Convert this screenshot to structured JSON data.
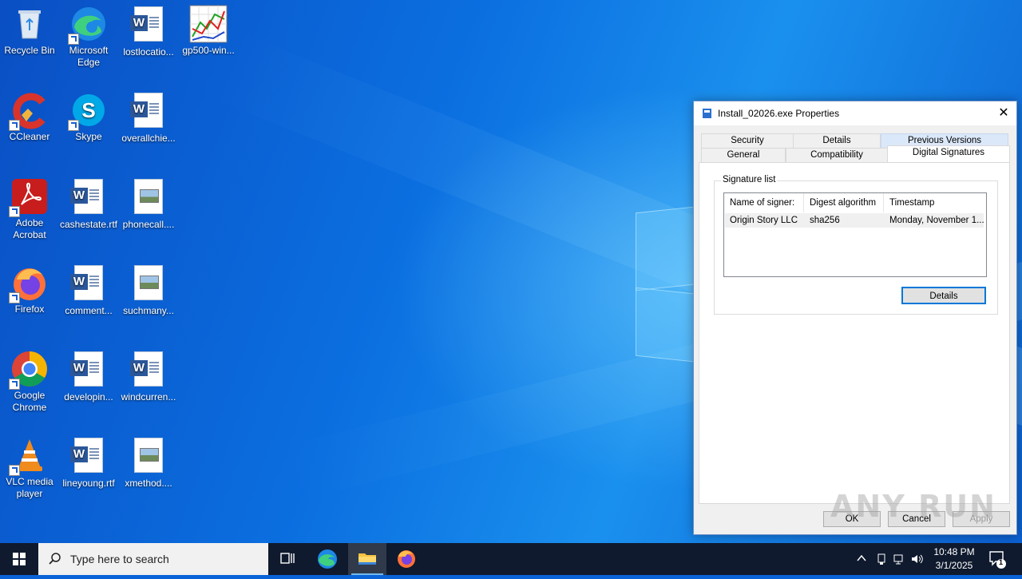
{
  "desktop": {
    "icons": [
      {
        "label": "Recycle Bin"
      },
      {
        "label": "Microsoft Edge"
      },
      {
        "label": "lostlocatio..."
      },
      {
        "label": "gp500-win..."
      },
      {
        "label": "CCleaner"
      },
      {
        "label": "Skype"
      },
      {
        "label": "overallchie..."
      },
      {
        "label": "Adobe Acrobat"
      },
      {
        "label": "cashestate.rtf"
      },
      {
        "label": "phonecall...."
      },
      {
        "label": "Firefox"
      },
      {
        "label": "comment..."
      },
      {
        "label": "suchmany..."
      },
      {
        "label": "Google Chrome"
      },
      {
        "label": "developin..."
      },
      {
        "label": "windcurren..."
      },
      {
        "label": "VLC media player"
      },
      {
        "label": "lineyoung.rtf"
      },
      {
        "label": "xmethod...."
      }
    ]
  },
  "dialog": {
    "title": "Install_02026.exe Properties",
    "tabs_row1": [
      "Security",
      "Details",
      "Previous Versions"
    ],
    "tabs_row2": [
      "General",
      "Compatibility",
      "Digital Signatures"
    ],
    "group_label": "Signature list",
    "columns": [
      "Name of signer:",
      "Digest algorithm",
      "Timestamp"
    ],
    "rows": [
      [
        "Origin Story LLC",
        "sha256",
        "Monday, November 1..."
      ]
    ],
    "details_button": "Details",
    "ok": "OK",
    "cancel": "Cancel",
    "apply": "Apply"
  },
  "taskbar": {
    "search_placeholder": "Type here to search",
    "time": "10:48 PM",
    "date": "3/1/2025",
    "notification_count": "1"
  },
  "watermark": "ANY RUN"
}
